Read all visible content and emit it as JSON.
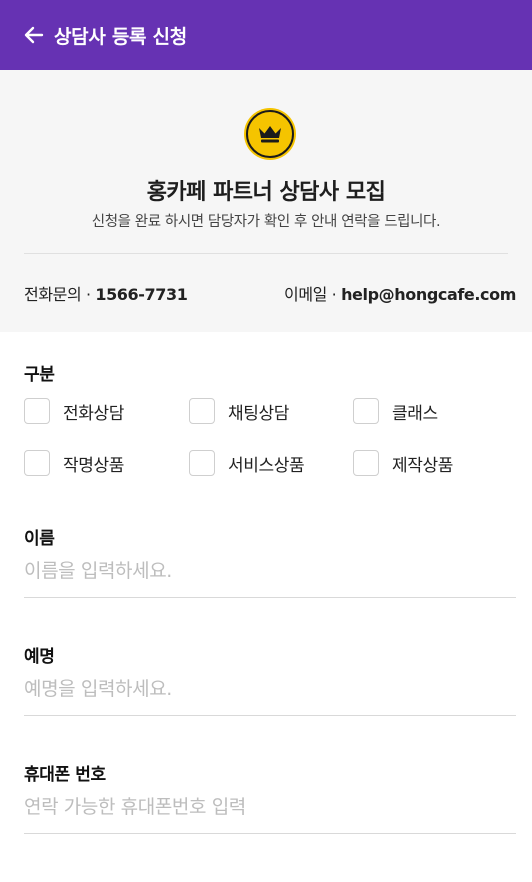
{
  "appbar": {
    "title": "상담사 등록 신청"
  },
  "header": {
    "title": "홍카페 파트너 상담사 모집",
    "subtitle": "신청을 완료 하시면 담당자가 확인 후 안내 연락을 드립니다.",
    "phone_label": "전화문의 · ",
    "phone_value": "1566-7731",
    "email_label": "이메일 · ",
    "email_value": "help@hongcafe.com",
    "badge_icon": "crown-icon",
    "badge_color": "#f5c400"
  },
  "category": {
    "label": "구분",
    "options": [
      "전화상담",
      "채팅상담",
      "클래스",
      "작명상품",
      "서비스상품",
      "제작상품"
    ]
  },
  "fields": {
    "name": {
      "label": "이름",
      "placeholder": "이름을 입력하세요."
    },
    "nickname": {
      "label": "예명",
      "placeholder": "예명을 입력하세요."
    },
    "phone": {
      "label": "휴대폰 번호",
      "placeholder": "연락 가능한 휴대폰번호 입력"
    }
  },
  "colors": {
    "primary": "#6632b3",
    "header_bg": "#f6f6f6",
    "placeholder": "#bdbdbd"
  }
}
